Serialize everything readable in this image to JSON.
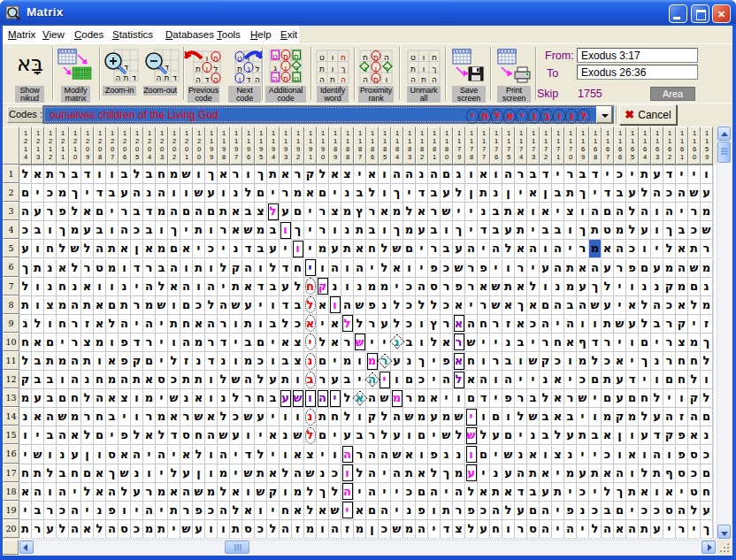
{
  "window": {
    "title": "Matrix"
  },
  "titlebar_buttons": {
    "minimize": "minimize",
    "maximize": "maximize",
    "close": "close"
  },
  "menu": {
    "items": [
      "Matrix",
      "View",
      "Codes",
      "Statistics",
      "Databases",
      "Tools",
      "Help",
      "Exit"
    ]
  },
  "toolbar": {
    "buttons": [
      {
        "name": "show-nikud",
        "label": "Show\nnikud"
      },
      {
        "name": "modify-matrix",
        "label": "Modify\nmatrix"
      },
      {
        "name": "zoom-in",
        "label": "Zoom-in"
      },
      {
        "name": "zoom-out",
        "label": "Zoom-out"
      },
      {
        "name": "previous-code",
        "label": "Previous\ncode"
      },
      {
        "name": "next-code",
        "label": "Next\ncode"
      },
      {
        "name": "additional-code",
        "label": "Additional\ncode"
      },
      {
        "name": "identify-word",
        "label": "Identify\nword"
      },
      {
        "name": "proximity-rank",
        "label": "Proximity\nrank"
      },
      {
        "name": "unmark-all",
        "label": "Unmark\nall"
      },
      {
        "name": "save-screen",
        "label": "Save\nscreen"
      },
      {
        "name": "print-screen",
        "label": "Print\nscreen"
      }
    ],
    "from_label": "From:",
    "from_value": "Exodus 3:17",
    "to_label": "To",
    "to_value": "Exodus 26:36",
    "skip_label": "Skip",
    "skip_value": "1755",
    "area_label": "Area"
  },
  "codes_bar": {
    "label": "Codes :",
    "value": "ourselves children of the Living God",
    "term_hebrew": "לנובניאלחי",
    "circled_letters_display": [
      "י",
      "ח",
      "ל",
      "א",
      "י",
      "נ",
      "ב",
      "ו",
      "נ",
      "ל"
    ],
    "cancel_label": "Cancel"
  },
  "matrix": {
    "col_header_start": 1214,
    "col_header_end": 1159,
    "row_count": 20,
    "col_count": 56,
    "rows_display_ltr": [
      "לאתרבדוובלבחמשוךארוךתארקלאציאוההנהםגואוהרבדירבדיכיתעדייו",
      "םיכמךידבעהנהוושעונלםירמאםינבלוךידבעלןתנןיאןבתךידבעלהכהשע",
      "הערפלאםירבדמהםהםתאבצלעםירצמץראמלארשיינבתאואיצוהםהלהוהירמ",
      "כבוךמעבוהכבוךיתוראשמבוךירונתבוךמעבוךידבעתיבבוךתטמלעוךבכש",
      "עוחלשלהתאןאמםאיכינדבעיוימעתאחלשםירבעהיהלאהוהירמאהכוילאתר",
      "ךתנאלרטמודרבהותולקהולדחיוהוהילאויפכשרפיוריעהתאהערפםעמהשמ",
      "לונחנאווניהלאהוהיתאדבעלחקנונממיכהסרפראשתאלונמעךליוננקמםג",
      "תוצמהתאםתרמשוםכלהשעיודבלאוהשפנלכללכאירשאךאםהבהשעיאלהכאלמ",
      "גלוחרזאלהיהיתחאהרותובלכאיאללרעלכוץראהחרזאכהיהוותשעלברקיז",
      "חאםירצמופדריוהמרדיבםיאצילארשיינבולארשיינבירחאףדריוםירצמך",
      "לבתמהתואפקםילזנדנומכובצנםימומרענךיפאחורבושקכומלכאיךנרחחל",
      "קבבוהנחמהתאסכתתולשהלעתוברעביהיוםכיהלאהוהיינאיכםתעדיוםחלו",
      "מעבםחלהאצומישנאונלרחבעשוהילאהשמרמאיוםדיפרבלארשיםעםחליוקל",
      "נאהשמרחביורמארשאלכשעיוונתחלוקלהשמעמשיוםולשבאביומקמלעהזהם",
      "ויבהאלםיפלאלדסחהשעויאנשלםיעברלעוםישלשלעםינבלעתבאןועדקפאנ",
      "ישונעןוסאהיהיאלוהידליואציוהרההשאופגנוםישנאוצנייכואוהופסכ",
      "חתלבחםאךשנוילעןומישתאלהשנכולהיהתאלךמעינעהתאימעתאהולתףסכם",
      "אהוהילאהלערמאהשמלאושקומלךלהיהייכםהיהלאתאדבעתיכילךתאואיטח",
      "יברכהינפויהיתרפכהלאויחאלאשיאםהינפותרפכהלעםהיפנכבםיככסהלע",
      "תרעלהאלהסכמתישעוותסכלהזמוהזמןכשמהידצלעחורסהיהילהאהתעיריך"
    ],
    "marks": [
      {
        "row": 7,
        "col": 23,
        "type": "ellipse",
        "color": "red"
      },
      {
        "row": 8,
        "col": 23,
        "type": "ellipse",
        "color": "red"
      },
      {
        "row": 9,
        "col": 23,
        "type": "ellipse",
        "color": "red"
      },
      {
        "row": 10,
        "col": 23,
        "type": "ellipse",
        "color": "red"
      },
      {
        "row": 11,
        "col": 23,
        "type": "ellipse",
        "color": "red"
      },
      {
        "row": 12,
        "col": 23,
        "type": "ellipse",
        "color": "red"
      },
      {
        "row": 14,
        "col": 23,
        "type": "ellipse",
        "color": "red"
      },
      {
        "row": 15,
        "col": 23,
        "type": "ellipse",
        "color": "red"
      },
      {
        "row": 6,
        "col": 23,
        "type": "box",
        "color": "blue"
      },
      {
        "row": 13,
        "col": 21,
        "type": "box",
        "color": "purple"
      },
      {
        "row": 13,
        "col": 22,
        "type": "box",
        "color": "purple"
      },
      {
        "row": 13,
        "col": 23,
        "type": "box",
        "color": "purple"
      },
      {
        "row": 13,
        "col": 24,
        "type": "box",
        "color": "purple"
      },
      {
        "row": 13,
        "col": 25,
        "type": "box",
        "color": "purple"
      },
      {
        "row": 9,
        "col": 35,
        "type": "box",
        "color": "purple"
      },
      {
        "row": 10,
        "col": 35,
        "type": "box",
        "color": "purple"
      },
      {
        "row": 11,
        "col": 35,
        "type": "box",
        "color": "purple"
      },
      {
        "row": 12,
        "col": 35,
        "type": "box",
        "color": "purple"
      },
      {
        "row": 3,
        "col": 20,
        "type": "box",
        "color": "magenta"
      },
      {
        "row": 4,
        "col": 21,
        "type": "box",
        "color": "magenta"
      },
      {
        "row": 5,
        "col": 22,
        "type": "box",
        "color": "magenta"
      },
      {
        "row": 7,
        "col": 24,
        "type": "box",
        "color": "magenta"
      },
      {
        "row": 8,
        "col": 25,
        "type": "box",
        "color": "magenta"
      },
      {
        "row": 9,
        "col": 26,
        "type": "box",
        "color": "magenta"
      },
      {
        "row": 10,
        "col": 27,
        "type": "box",
        "color": "magenta"
      },
      {
        "row": 11,
        "col": 28,
        "type": "box",
        "color": "magenta"
      },
      {
        "row": 12,
        "col": 29,
        "type": "box",
        "color": "magenta"
      },
      {
        "row": 13,
        "col": 30,
        "type": "box",
        "color": "magenta"
      },
      {
        "row": 14,
        "col": 36,
        "type": "box",
        "color": "magenta"
      },
      {
        "row": 15,
        "col": 36,
        "type": "box",
        "color": "magenta"
      },
      {
        "row": 16,
        "col": 36,
        "type": "box",
        "color": "magenta"
      },
      {
        "row": 17,
        "col": 36,
        "type": "box",
        "color": "magenta"
      },
      {
        "row": 16,
        "col": 26,
        "type": "box",
        "color": "magenta"
      },
      {
        "row": 17,
        "col": 26,
        "type": "box",
        "color": "magenta"
      },
      {
        "row": 18,
        "col": 26,
        "type": "box",
        "color": "magenta"
      },
      {
        "row": 19,
        "col": 26,
        "type": "box",
        "color": "magenta"
      },
      {
        "row": 10,
        "col": 30,
        "type": "diamond",
        "color": "teal"
      },
      {
        "row": 11,
        "col": 29,
        "type": "diamond",
        "color": "teal"
      },
      {
        "row": 12,
        "col": 28,
        "type": "diamond",
        "color": "teal"
      },
      {
        "row": 13,
        "col": 27,
        "type": "diamond",
        "color": "teal"
      },
      {
        "row": 5,
        "col": 46,
        "type": "selected",
        "color": "blue-bg"
      }
    ]
  },
  "colors": {
    "titlebar_blue": "#1e5be0",
    "toolbar_beige": "#ece9d8",
    "label_gray": "#bdbdbd",
    "combo_blue": "#316ac5",
    "code_red": "#f00000",
    "magenta": "#ff00ff",
    "purple": "#8800bb",
    "teal": "#008f8f",
    "selected_blue": "#2f62c4",
    "ui_purple": "#800080"
  }
}
